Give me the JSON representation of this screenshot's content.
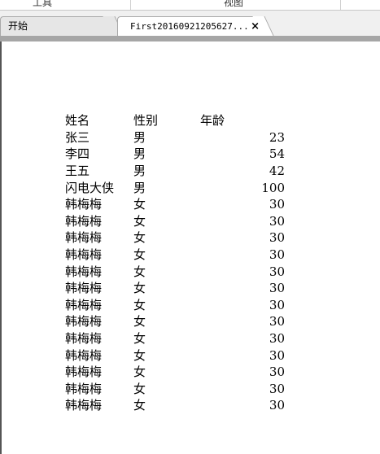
{
  "menu": {
    "tools": "工具",
    "view": "视图"
  },
  "tabs": [
    {
      "label": "开始",
      "active": false
    },
    {
      "label": "First20160921205627...",
      "active": true,
      "close": "×"
    }
  ],
  "table": {
    "headers": [
      "姓名",
      "性别",
      "年龄"
    ],
    "rows": [
      [
        "张三",
        "男",
        "23"
      ],
      [
        "李四",
        "男",
        "54"
      ],
      [
        "王五",
        "男",
        "42"
      ],
      [
        "闪电大侠",
        "男",
        "100"
      ],
      [
        "韩梅梅",
        "女",
        "30"
      ],
      [
        "韩梅梅",
        "女",
        "30"
      ],
      [
        "韩梅梅",
        "女",
        "30"
      ],
      [
        "韩梅梅",
        "女",
        "30"
      ],
      [
        "韩梅梅",
        "女",
        "30"
      ],
      [
        "韩梅梅",
        "女",
        "30"
      ],
      [
        "韩梅梅",
        "女",
        "30"
      ],
      [
        "韩梅梅",
        "女",
        "30"
      ],
      [
        "韩梅梅",
        "女",
        "30"
      ],
      [
        "韩梅梅",
        "女",
        "30"
      ],
      [
        "韩梅梅",
        "女",
        "30"
      ],
      [
        "韩梅梅",
        "女",
        "30"
      ],
      [
        "韩梅梅",
        "女",
        "30"
      ]
    ]
  }
}
